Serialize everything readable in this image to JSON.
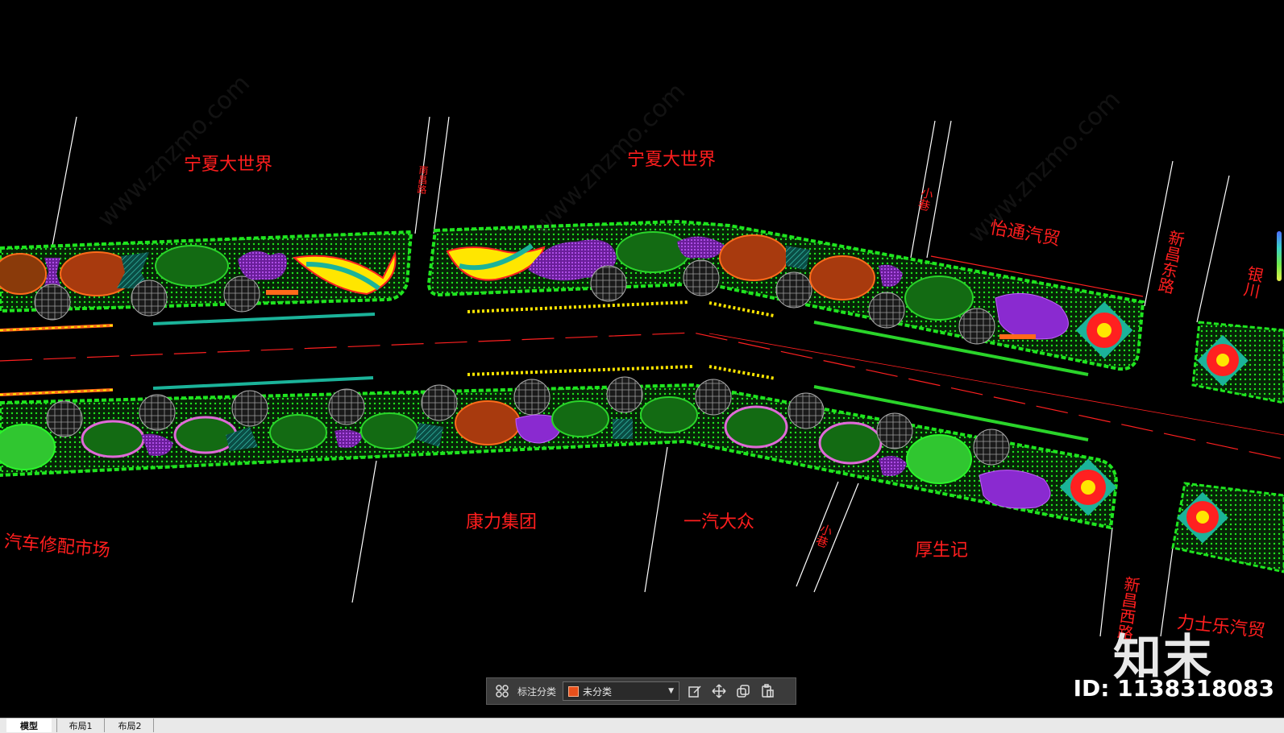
{
  "drawing": {
    "labels": {
      "ningxia_world_1": "宁夏大世界",
      "ningxia_world_2": "宁夏大世界",
      "yitong_auto": "怡通汽贸",
      "auto_parts_market": "汽车修配市场",
      "kangli_group": "康力集团",
      "faw_vw": "一汽大众",
      "houshengji": "厚生记",
      "lishile_auto": "力士乐汽贸",
      "xinchang_east_road": "新昌东路",
      "xinchang_west_road": "新昌西路",
      "small_street_1": "小巷",
      "small_street_2": "小巷",
      "road_left": "南昌路",
      "cut_right": "银川"
    },
    "watermark": "www.znzmo.com",
    "brand": "知末",
    "id_text": "ID: 1138318083"
  },
  "toolbar": {
    "label": "标注分类",
    "select_value": "未分类",
    "select_color": "#e8501b",
    "icons": [
      "grid-icon",
      "edit-icon",
      "move-icon",
      "copy-icon",
      "paste-icon"
    ]
  },
  "tabs": [
    {
      "label": "模型",
      "active": true
    },
    {
      "label": "布局1",
      "active": false
    },
    {
      "label": "布局2",
      "active": false
    }
  ],
  "colors": {
    "background": "#000000",
    "median_green": "#1fe51f",
    "label_red": "#ff1e1e",
    "flower_red": "#ff2020",
    "flower_yellow": "#ffe600",
    "lawn_teal": "#1bb39a",
    "shrub_purple": "#9a34d8"
  }
}
